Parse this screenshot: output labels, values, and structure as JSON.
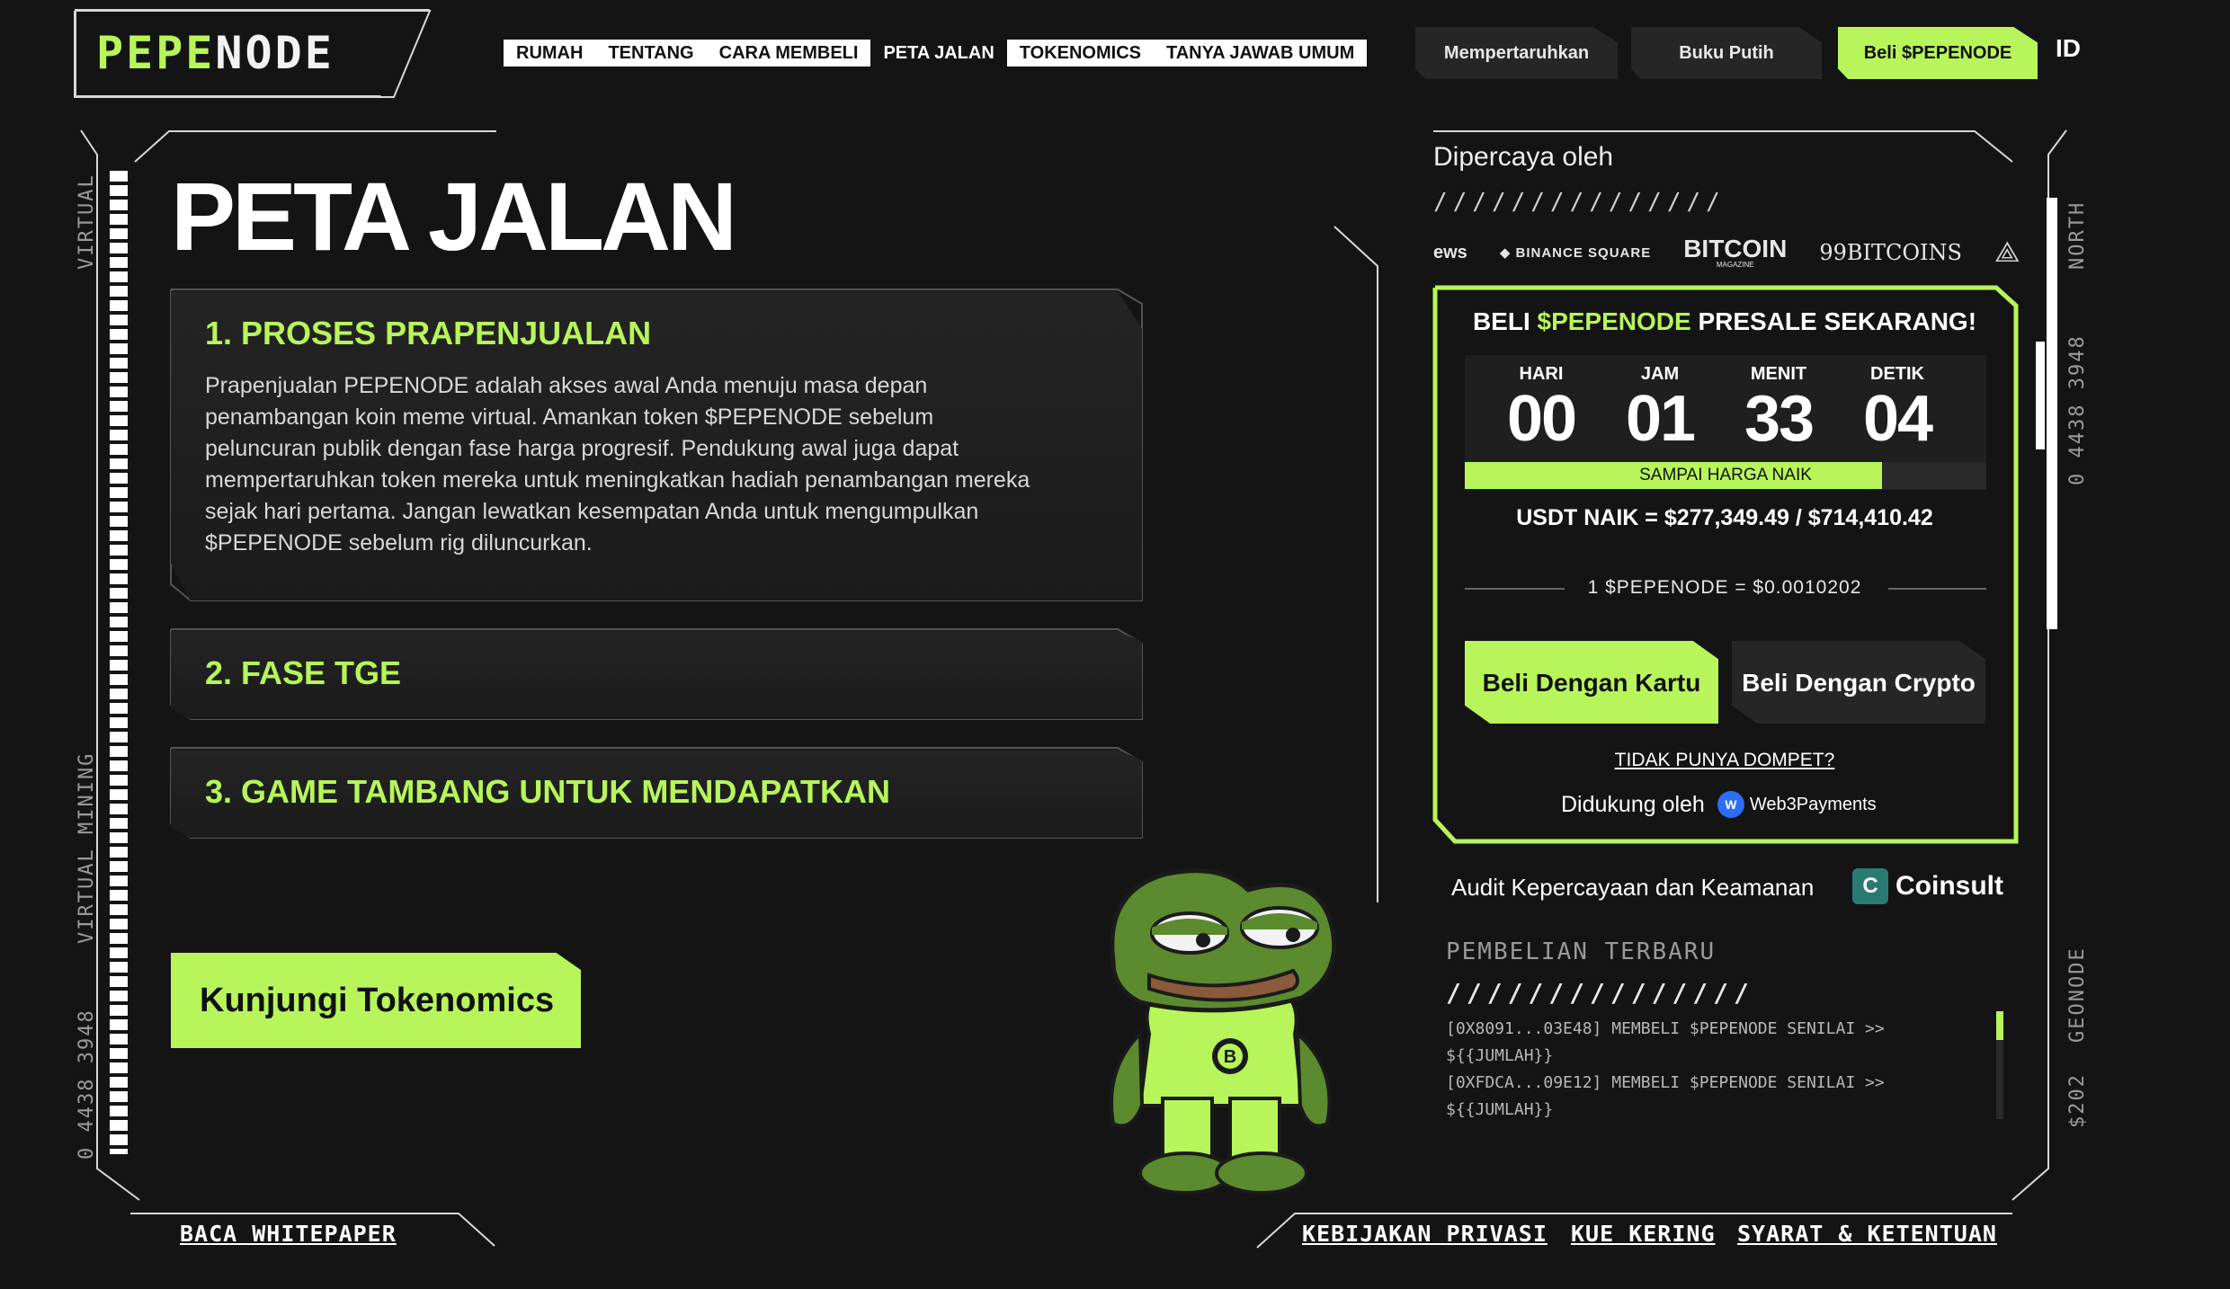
{
  "brand": {
    "logo_left": "PEPE",
    "logo_right": "NODE"
  },
  "nav": [
    {
      "label": "RUMAH"
    },
    {
      "label": "TENTANG"
    },
    {
      "label": "CARA MEMBELI"
    },
    {
      "label": "PETA JALAN",
      "active": true
    },
    {
      "label": "TOKENOMICS"
    },
    {
      "label": "TANYA JAWAB UMUM"
    }
  ],
  "header_buttons": {
    "stake": "Mempertaruhkan",
    "whitepaper": "Buku Putih",
    "buy": "Beli $PEPENODE"
  },
  "language": "ID",
  "side_labels": {
    "virtual": "VIRTUAL",
    "virtual_mining": "VIRTUAL MINING",
    "code_left": "0 4438 3948",
    "north": "NORTH",
    "code_right": "0 4438 3948",
    "geonode": "GEONODE",
    "dollar": "$202"
  },
  "roadmap": {
    "title": "PETA JALAN",
    "items": [
      {
        "title": "1. PROSES PRAPENJUALAN",
        "body": "Prapenjualan PEPENODE adalah akses awal Anda menuju masa depan penambangan koin meme virtual. Amankan token $PEPENODE sebelum peluncuran publik dengan fase harga progresif. Pendukung awal juga dapat mempertaruhkan token mereka untuk meningkatkan hadiah penambangan mereka sejak hari pertama. Jangan lewatkan kesempatan Anda untuk mengumpulkan $PEPENODE sebelum rig diluncurkan.",
        "expanded": true
      },
      {
        "title": "2. FASE TGE",
        "expanded": false
      },
      {
        "title": "3. GAME TAMBANG UNTUK MENDAPATKAN",
        "expanded": false
      }
    ],
    "cta": "Kunjungi Tokenomics"
  },
  "trust": {
    "heading": "Dipercaya oleh",
    "slashes": "///////////////",
    "logos": [
      "ews",
      "BINANCE SQUARE",
      "BITCOIN",
      "MAGAZINE",
      "99BITCOINS"
    ]
  },
  "presale": {
    "title_prefix": "BELI ",
    "title_token": "$PEPENODE",
    "title_suffix": " PRESALE SEKARANG!",
    "countdown": [
      {
        "label": "HARI",
        "value": "00"
      },
      {
        "label": "JAM",
        "value": "01"
      },
      {
        "label": "MENIT",
        "value": "33"
      },
      {
        "label": "DETIK",
        "value": "04"
      }
    ],
    "progress_label": "SAMPAI HARGA NAIK",
    "progress_fraction": 0.8,
    "raised": "USDT NAIK = $277,349.49 / $714,410.42",
    "rate": "1 $PEPENODE = $0.0010202",
    "btn_card": "Beli Dengan Kartu",
    "btn_crypto": "Beli Dengan Crypto",
    "no_wallet": "TIDAK PUNYA DOMPET?",
    "powered_by": "Didukung oleh",
    "powered_brand": "Web3Payments"
  },
  "audit": {
    "label": "Audit Kepercayaan dan Keamanan",
    "brand": "Coinsult"
  },
  "recent": {
    "heading": "PEMBELIAN TERBARU",
    "slashes": "///////////////",
    "rows": [
      "[0X8091...03E48] MEMBELI $PEPENODE SENILAI >>",
      "${{JUMLAH}}",
      "[0XFDCA...09E12] MEMBELI $PEPENODE SENILAI >>",
      "${{JUMLAH}}"
    ]
  },
  "footer": {
    "whitepaper": "BACA WHITEPAPER",
    "privacy": "KEBIJAKAN PRIVASI",
    "cookies": "KUE KERING",
    "terms": "SYARAT & KETENTUAN"
  },
  "colors": {
    "accent": "#b7f55a",
    "background": "#141414"
  }
}
